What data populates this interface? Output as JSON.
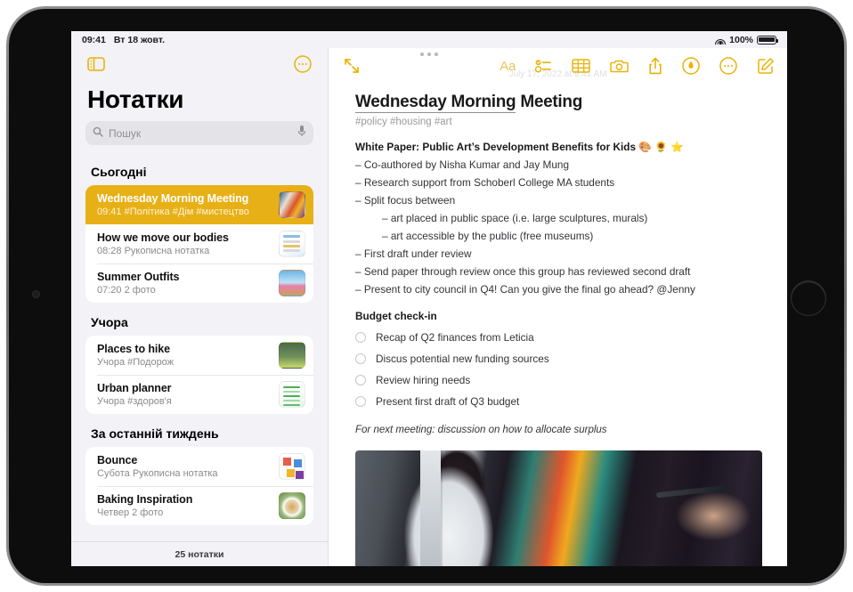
{
  "status_bar": {
    "time": "09:41",
    "date": "Вт 18 жовт.",
    "wifi_icon": "wifi-icon",
    "battery_percent": "100%",
    "battery_icon": "battery-full-icon"
  },
  "sidebar": {
    "toolbar": {
      "sidebar_toggle_icon": "sidebar-toggle-icon",
      "more_icon": "more-circle-icon"
    },
    "title": "Нотатки",
    "search": {
      "placeholder": "Пошук",
      "value": "",
      "search_icon": "search-icon",
      "mic_icon": "microphone-icon"
    },
    "sections": [
      {
        "header": "Сьогодні",
        "notes": [
          {
            "title": "Wednesday Morning Meeting",
            "meta": "09:41  #Політика #Дім #мистецтво",
            "selected": true,
            "thumb": "th-meeting"
          },
          {
            "title": "How we move our bodies",
            "meta": "08:28  Рукописна нотатка",
            "selected": false,
            "thumb": "th-bodies"
          },
          {
            "title": "Summer Outfits",
            "meta": "07:20  2 фото",
            "selected": false,
            "thumb": "th-summer"
          }
        ]
      },
      {
        "header": "Учора",
        "notes": [
          {
            "title": "Places to hike",
            "meta": "Учора  #Подорож",
            "selected": false,
            "thumb": "th-hike"
          },
          {
            "title": "Urban planner",
            "meta": "Учора  #здоров'я",
            "selected": false,
            "thumb": "th-urban"
          }
        ]
      },
      {
        "header": "За останній тиждень",
        "notes": [
          {
            "title": "Bounce",
            "meta": "Субота  Рукописна нотатка",
            "selected": false,
            "thumb": "th-bounce"
          },
          {
            "title": "Baking Inspiration",
            "meta": "Четвер  2 фото",
            "selected": false,
            "thumb": "th-baking"
          }
        ]
      }
    ],
    "footer_count": "25 нотатки"
  },
  "detail": {
    "toolbar": {
      "expand_icon": "expand-diagonal-icon",
      "format_label": "Aa",
      "checklist_icon": "checklist-icon",
      "table_icon": "table-icon",
      "camera_icon": "camera-icon",
      "share_icon": "share-icon",
      "markup_icon": "markup-pen-icon",
      "more_icon": "more-circle-icon",
      "compose_icon": "compose-icon"
    },
    "date_line": "July 17, 2022 at 9:41 AM",
    "note_title_underlined": "Wednesday Morning",
    "note_title_rest": " Meeting",
    "tags": "#policy #housing #art",
    "heading": "White Paper: Public Art’s Development Benefits for Kids 🎨 🌻 ⭐",
    "bullets": [
      {
        "text": "– Co-authored by Nisha Kumar and Jay Mung",
        "indent": false
      },
      {
        "text": "– Research support from Schoberl College MA students",
        "indent": false
      },
      {
        "text": "– Split focus between",
        "indent": false
      },
      {
        "text": "– art placed in public space (i.e. large sculptures, murals)",
        "indent": true
      },
      {
        "text": "– art accessible by the public (free museums)",
        "indent": true
      },
      {
        "text": "– First draft under review",
        "indent": false
      },
      {
        "text": "– Send paper through review once this group has reviewed second draft",
        "indent": false
      },
      {
        "text": "– Present to city council in Q4! Can you give the final go ahead? @Jenny",
        "indent": false
      }
    ],
    "budget_heading": "Budget check-in",
    "checklist": [
      {
        "label": "Recap of Q2 finances from Leticia",
        "checked": false
      },
      {
        "label": "Discus potential new funding sources",
        "checked": false
      },
      {
        "label": "Review hiring needs",
        "checked": false
      },
      {
        "label": "Present first draft of Q3 budget",
        "checked": false
      }
    ],
    "footnote": "For next meeting: discussion on how to allocate surplus",
    "photo_alt": "woman-painting-mural-photo"
  },
  "colors": {
    "accent": "#eab308",
    "selected_row": "#e8b017",
    "sidebar_bg": "#f2f2f7"
  }
}
